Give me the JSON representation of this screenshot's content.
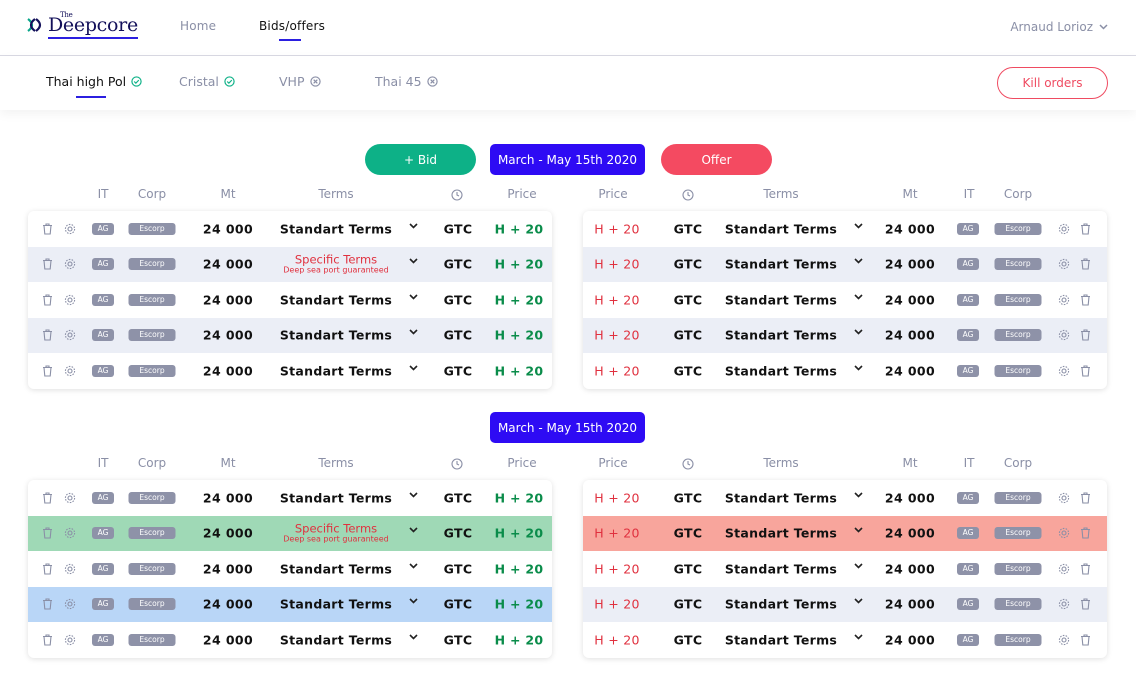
{
  "app": {
    "logo_small": "The",
    "logo_main": "Deepcore",
    "nav": [
      {
        "label": "Home"
      },
      {
        "label": "Bids/offers"
      }
    ],
    "user_name": "Arnaud Lorioz"
  },
  "subnav": {
    "tabs": [
      {
        "label": "Thai high Pol",
        "status": "ok"
      },
      {
        "label": "Cristal",
        "status": "ok"
      },
      {
        "label": "VHP",
        "status": "x"
      },
      {
        "label": "Thai 45",
        "status": "x"
      }
    ],
    "kill_label": "Kill orders"
  },
  "actions": {
    "bid_label": "+ Bid",
    "offer_label": "Offer"
  },
  "sections": [
    {
      "period": "March - May 15th 2020"
    },
    {
      "period": "March - May 15th 2020"
    }
  ],
  "headers": {
    "bid": {
      "it": "IT",
      "corp": "Corp",
      "mt": "Mt",
      "terms": "Terms",
      "price": "Price"
    },
    "offer": {
      "price": "Price",
      "terms": "Terms",
      "mt": "Mt",
      "it": "IT",
      "corp": "Corp"
    }
  },
  "bid_rows": [
    {
      "it": "AG",
      "corp": "Escorp",
      "mt": "24 000",
      "terms": "Standart Terms",
      "sub": "",
      "validity": "GTC",
      "price": "H + 20"
    },
    {
      "it": "AG",
      "corp": "Escorp",
      "mt": "24 000",
      "terms": "Specific Terms",
      "sub": "Deep sea port guaranteed",
      "validity": "GTC",
      "price": "H + 20"
    },
    {
      "it": "AG",
      "corp": "Escorp",
      "mt": "24 000",
      "terms": "Standart Terms",
      "sub": "",
      "validity": "GTC",
      "price": "H + 20"
    },
    {
      "it": "AG",
      "corp": "Escorp",
      "mt": "24 000",
      "terms": "Standart Terms",
      "sub": "",
      "validity": "GTC",
      "price": "H + 20"
    },
    {
      "it": "AG",
      "corp": "Escorp",
      "mt": "24 000",
      "terms": "Standart Terms",
      "sub": "",
      "validity": "GTC",
      "price": "H + 20"
    }
  ],
  "offer_rows": [
    {
      "price": "H + 20",
      "validity": "GTC",
      "terms": "Standart Terms",
      "mt": "24 000",
      "it": "AG",
      "corp": "Escorp"
    },
    {
      "price": "H + 20",
      "validity": "GTC",
      "terms": "Standart Terms",
      "mt": "24 000",
      "it": "AG",
      "corp": "Escorp"
    },
    {
      "price": "H + 20",
      "validity": "GTC",
      "terms": "Standart Terms",
      "mt": "24 000",
      "it": "AG",
      "corp": "Escorp"
    },
    {
      "price": "H + 20",
      "validity": "GTC",
      "terms": "Standart Terms",
      "mt": "24 000",
      "it": "AG",
      "corp": "Escorp"
    },
    {
      "price": "H + 20",
      "validity": "GTC",
      "terms": "Standart Terms",
      "mt": "24 000",
      "it": "AG",
      "corp": "Escorp"
    }
  ],
  "bid_rows_2": [
    {
      "it": "AG",
      "corp": "Escorp",
      "mt": "24 000",
      "terms": "Standart Terms",
      "sub": "",
      "validity": "GTC",
      "price": "H + 20"
    },
    {
      "it": "AG",
      "corp": "Escorp",
      "mt": "24 000",
      "terms": "Specific Terms",
      "sub": "Deep sea port guaranteed",
      "validity": "GTC",
      "price": "H + 20",
      "highlight": "green"
    },
    {
      "it": "AG",
      "corp": "Escorp",
      "mt": "24 000",
      "terms": "Standart Terms",
      "sub": "",
      "validity": "GTC",
      "price": "H + 20"
    },
    {
      "it": "AG",
      "corp": "Escorp",
      "mt": "24 000",
      "terms": "Standart Terms",
      "sub": "",
      "validity": "GTC",
      "price": "H + 20",
      "highlight": "blue"
    },
    {
      "it": "AG",
      "corp": "Escorp",
      "mt": "24 000",
      "terms": "Standart Terms",
      "sub": "",
      "validity": "GTC",
      "price": "H + 20"
    }
  ],
  "offer_rows_2": [
    {
      "price": "H + 20",
      "validity": "GTC",
      "terms": "Standart Terms",
      "mt": "24 000",
      "it": "AG",
      "corp": "Escorp"
    },
    {
      "price": "H + 20",
      "validity": "GTC",
      "terms": "Standart Terms",
      "mt": "24 000",
      "it": "AG",
      "corp": "Escorp",
      "highlight": "red"
    },
    {
      "price": "H + 20",
      "validity": "GTC",
      "terms": "Standart Terms",
      "mt": "24 000",
      "it": "AG",
      "corp": "Escorp"
    },
    {
      "price": "H + 20",
      "validity": "GTC",
      "terms": "Standart Terms",
      "mt": "24 000",
      "it": "AG",
      "corp": "Escorp"
    },
    {
      "price": "H + 20",
      "validity": "GTC",
      "terms": "Standart Terms",
      "mt": "24 000",
      "it": "AG",
      "corp": "Escorp"
    }
  ],
  "colors": {
    "accent": "#2e0bf4",
    "bid_green": "#0db187",
    "offer_red": "#f44a61",
    "row_alt": "#ebeef6",
    "highlight_green": "#9fd9b6",
    "highlight_blue": "#b9d6f7",
    "highlight_red": "#f8a59c"
  },
  "icons": {
    "delete": "trash-icon",
    "settings": "gear-icon",
    "dropdown": "chevron-down-icon",
    "validity": "clock-icon",
    "status_ok": "check-circle-icon",
    "status_x": "x-circle-icon"
  }
}
